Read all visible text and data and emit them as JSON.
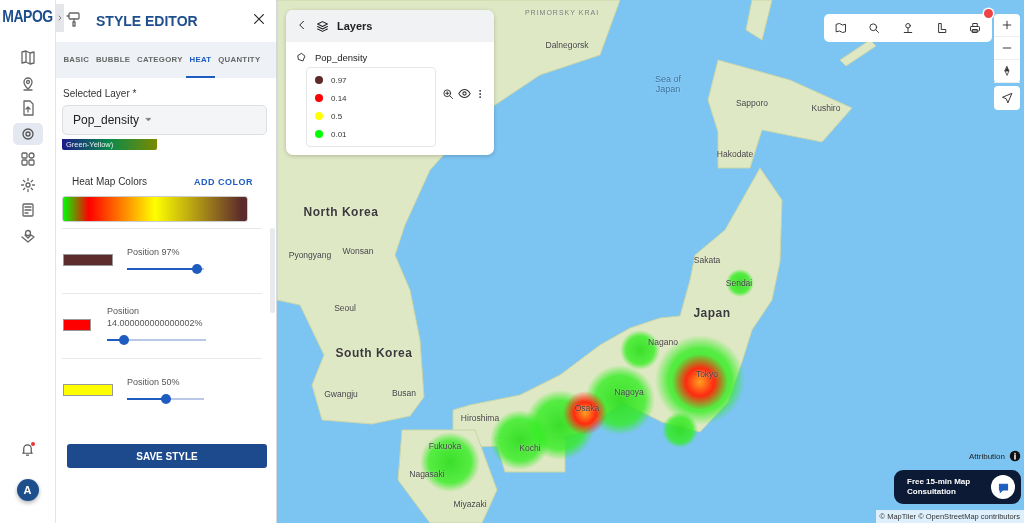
{
  "app": {
    "logo": "MAPOG",
    "avatar": "A"
  },
  "style_editor": {
    "title": "STYLE EDITOR",
    "tabs": [
      {
        "label": "BASIC",
        "selected": false
      },
      {
        "label": "BUBBLE",
        "selected": false
      },
      {
        "label": "CATEGORY",
        "selected": false
      },
      {
        "label": "HEAT",
        "selected": true
      },
      {
        "label": "QUANTITY",
        "selected": false
      }
    ],
    "selected_layer_label": "Selected Layer *",
    "selected_layer": "Pop_density",
    "preset_label": "Green-Yellow)",
    "colors_label": "Heat Map Colors",
    "add_color": "ADD COLOR",
    "stops": [
      {
        "color": "#5c2b2b",
        "label": "Position 97%",
        "level": 0.97
      },
      {
        "color": "#ff0000",
        "label": "Position 14.000000000000002%",
        "level": 0.14
      },
      {
        "color": "#ffff00",
        "label": "Position 50%",
        "level": 0.5
      }
    ],
    "save": "SAVE STYLE"
  },
  "layers_panel": {
    "title": "Layers",
    "layer_name": "Pop_density",
    "legend": [
      {
        "color": "#5c2b2b",
        "label": "0.97"
      },
      {
        "color": "#ff0000",
        "label": "0.14"
      },
      {
        "color": "#ffff00",
        "label": "0.5"
      },
      {
        "color": "#00ff00",
        "label": "0.01"
      }
    ]
  },
  "map": {
    "labels": [
      {
        "kind": "region",
        "text": "PRIMORSKY KRAI"
      },
      {
        "kind": "city",
        "text": "Dalnegorsk"
      },
      {
        "kind": "sea",
        "text": "Sea of Japan"
      },
      {
        "kind": "city",
        "text": "Sapporo"
      },
      {
        "kind": "city",
        "text": "Kushiro"
      },
      {
        "kind": "city",
        "text": "Hakodate"
      },
      {
        "kind": "country",
        "text": "North Korea"
      },
      {
        "kind": "city",
        "text": "Wonsan"
      },
      {
        "kind": "city",
        "text": "Pyongyang"
      },
      {
        "kind": "city",
        "text": "Sakata"
      },
      {
        "kind": "city",
        "text": "Sendai"
      },
      {
        "kind": "city",
        "text": "Seoul"
      },
      {
        "kind": "country",
        "text": "Japan"
      },
      {
        "kind": "city",
        "text": "Nagano"
      },
      {
        "kind": "country",
        "text": "South Korea"
      },
      {
        "kind": "city",
        "text": "Tokyo"
      },
      {
        "kind": "city",
        "text": "Gwangju"
      },
      {
        "kind": "city",
        "text": "Busan"
      },
      {
        "kind": "city",
        "text": "Nagoya"
      },
      {
        "kind": "city",
        "text": "Osaka"
      },
      {
        "kind": "city",
        "text": "Hiroshima"
      },
      {
        "kind": "city",
        "text": "Fukuoka"
      },
      {
        "kind": "city",
        "text": "Kochi"
      },
      {
        "kind": "city",
        "text": "Nagasaki"
      },
      {
        "kind": "city",
        "text": "Miyazaki"
      }
    ],
    "attribution": "Attribution",
    "consultation": "Free 15-min Map Consultation",
    "credits": "© MapTiler © OpenStreetMap contributors"
  }
}
